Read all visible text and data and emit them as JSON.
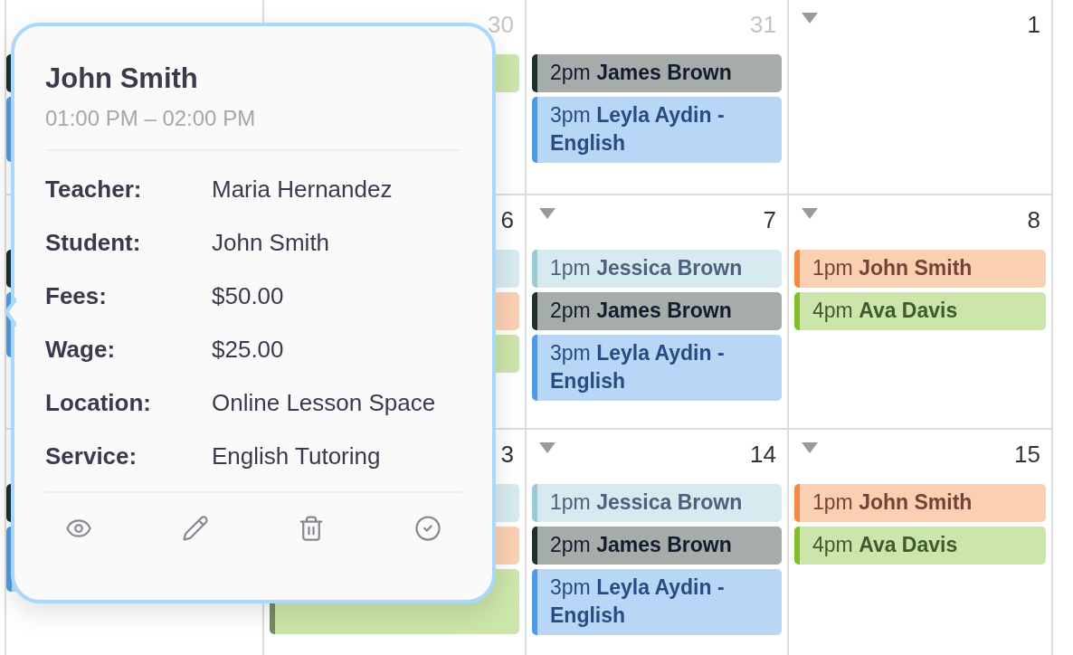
{
  "calendar": {
    "weeks": [
      {
        "days": [
          {
            "events": [
              {
                "kind": "stripe_edge",
                "color": "#1e302b"
              },
              {
                "kind": "stripe_edge_tall",
                "color": "#4d9be8"
              }
            ]
          },
          {
            "day": "30",
            "muted": true,
            "menu_arrow": false,
            "events": [
              {
                "kind": "fill_edge",
                "color": "#cce5aa"
              }
            ]
          },
          {
            "day": "31",
            "muted": true,
            "menu_arrow": false,
            "events": [
              {
                "kind": "event",
                "time": "2pm",
                "title": "James Brown",
                "color": "#1e302b"
              },
              {
                "kind": "event",
                "time": "3pm",
                "title": "Leyla Aydin - English",
                "color": "#4d9be8"
              }
            ]
          },
          {
            "day": "1",
            "muted": false,
            "menu_arrow": true
          }
        ]
      },
      {
        "days": [
          {
            "events": [
              {
                "kind": "stripe_edge",
                "color": "#1e302b"
              },
              {
                "kind": "stripe_edge_tall",
                "color": "#4d9be8"
              }
            ]
          },
          {
            "day": "6",
            "muted": false,
            "events": [
              {
                "kind": "fill_edge",
                "color": "#d7eaef"
              },
              {
                "kind": "fill_edge",
                "color": "#fbcfb2"
              },
              {
                "kind": "fill_edge",
                "color": "#cce5aa"
              }
            ]
          },
          {
            "day": "7",
            "muted": false,
            "menu_arrow": true,
            "events": [
              {
                "kind": "event",
                "time": "1pm",
                "title": "Jessica Brown",
                "color": "#9ccbd8"
              },
              {
                "kind": "event",
                "time": "2pm",
                "title": "James Brown",
                "color": "#1e302b"
              },
              {
                "kind": "event",
                "time": "3pm",
                "title": "Leyla Aydin - English",
                "color": "#4d9be8"
              }
            ]
          },
          {
            "day": "8",
            "muted": false,
            "menu_arrow": true,
            "events": [
              {
                "kind": "event",
                "time": "1pm",
                "title": "John Smith",
                "color": "#f6883f"
              },
              {
                "kind": "event",
                "time": "4pm",
                "title": "Ava Davis",
                "color": "#80be2a"
              }
            ]
          }
        ]
      },
      {
        "days": [
          {
            "events": [
              {
                "kind": "stripe_edge",
                "color": "#1e302b"
              },
              {
                "kind": "stripe_edge_tall",
                "color": "#4d9be8"
              }
            ]
          },
          {
            "day": "3",
            "muted": false,
            "events": [
              {
                "kind": "fill_edge",
                "color": "#d7eaef"
              },
              {
                "kind": "fill_edge",
                "color": "#fbcfb2"
              },
              {
                "kind": "fill_edge_tall",
                "color": "#cce5aa"
              }
            ]
          },
          {
            "day": "14",
            "muted": false,
            "menu_arrow": true,
            "events": [
              {
                "kind": "event",
                "time": "1pm",
                "title": "Jessica Brown",
                "color": "#9ccbd8"
              },
              {
                "kind": "event",
                "time": "2pm",
                "title": "James Brown",
                "color": "#1e302b"
              },
              {
                "kind": "event",
                "time": "3pm",
                "title": "Leyla Aydin - English",
                "color": "#4d9be8"
              }
            ]
          },
          {
            "day": "15",
            "muted": false,
            "menu_arrow": true,
            "events": [
              {
                "kind": "event",
                "time": "1pm",
                "title": "John Smith",
                "color": "#f6883f"
              },
              {
                "kind": "event",
                "time": "4pm",
                "title": "Ava Davis",
                "color": "#80be2a"
              }
            ]
          }
        ]
      }
    ]
  },
  "popover": {
    "title": "John Smith",
    "time_range": "01:00 PM – 02:00 PM",
    "details": [
      {
        "label": "Teacher:",
        "value": "Maria Hernandez"
      },
      {
        "label": "Student:",
        "value": "John Smith"
      },
      {
        "label": "Fees:",
        "value": "$50.00"
      },
      {
        "label": "Wage:",
        "value": "$25.00"
      },
      {
        "label": "Location:",
        "value": "Online Lesson Space"
      },
      {
        "label": "Service:",
        "value": "English Tutoring"
      }
    ],
    "actions": [
      {
        "kind": "view"
      },
      {
        "kind": "edit"
      },
      {
        "kind": "delete"
      },
      {
        "kind": "complete"
      }
    ]
  }
}
